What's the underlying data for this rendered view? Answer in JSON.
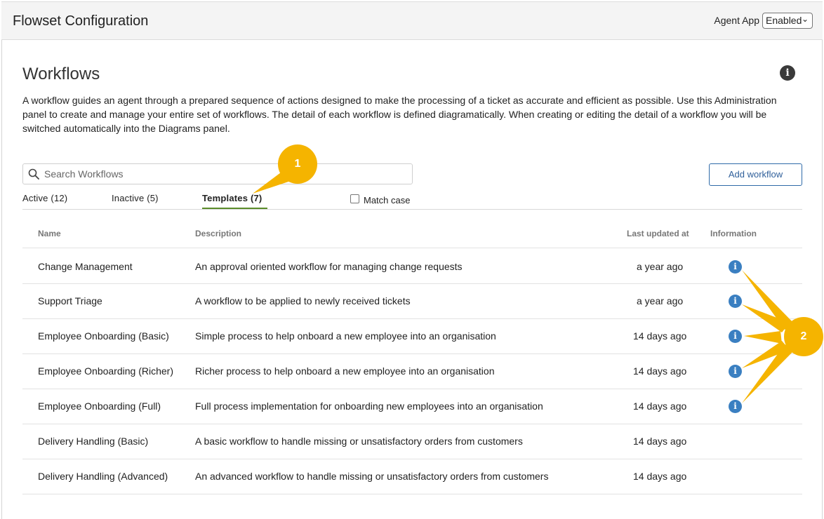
{
  "header": {
    "title": "Flowset Configuration",
    "agent_app_label": "Agent App",
    "agent_app_value": "Enabled"
  },
  "main": {
    "title": "Workflows",
    "description": "A workflow guides an agent through a prepared sequence of actions designed to make the processing of a ticket as accurate and efficient as possible. Use this Administration panel to create and manage your entire set of workflows. The detail of each workflow is defined diagramatically. When creating or editing the detail of a workflow you will be switched automatically into the Diagrams panel.",
    "search_placeholder": "Search Workflows",
    "add_button": "Add workflow",
    "match_case_label": "Match case",
    "tabs": [
      {
        "label": "Active (12)"
      },
      {
        "label": "Inactive (5)"
      },
      {
        "label": "Templates (7)",
        "active": true
      }
    ]
  },
  "table": {
    "columns": [
      "Name",
      "Description",
      "Last updated at",
      "Information"
    ],
    "rows": [
      {
        "name": "Change Management",
        "description": "An approval oriented workflow for managing change requests",
        "updated": "a year ago"
      },
      {
        "name": "Support Triage",
        "description": "A workflow to be applied to newly received tickets",
        "updated": "a year ago"
      },
      {
        "name": "Employee Onboarding (Basic)",
        "description": "Simple process to help onboard a new employee into an organisation",
        "updated": "14 days ago"
      },
      {
        "name": "Employee Onboarding (Richer)",
        "description": "Richer process to help onboard a new employee into an organisation",
        "updated": "14 days ago"
      },
      {
        "name": "Employee Onboarding (Full)",
        "description": "Full process implementation for onboarding new employees into an organisation",
        "updated": "14 days ago"
      },
      {
        "name": "Delivery Handling (Basic)",
        "description": "A basic workflow to handle missing or unsatisfactory orders from customers",
        "updated": "14 days ago"
      },
      {
        "name": "Delivery Handling (Advanced)",
        "description": "An advanced workflow to handle missing or unsatisfactory orders from customers",
        "updated": "14 days ago"
      }
    ]
  },
  "annotations": {
    "callout_1": "1",
    "callout_2": "2",
    "color": "#f5b400"
  },
  "colors": {
    "accent_tab": "#5b8c2a",
    "info_icon": "#3a7fc1",
    "button_border": "#2f6aa8"
  },
  "icons": [
    "search-icon",
    "help-info-icon",
    "info-icon",
    "chevron-down-icon"
  ]
}
